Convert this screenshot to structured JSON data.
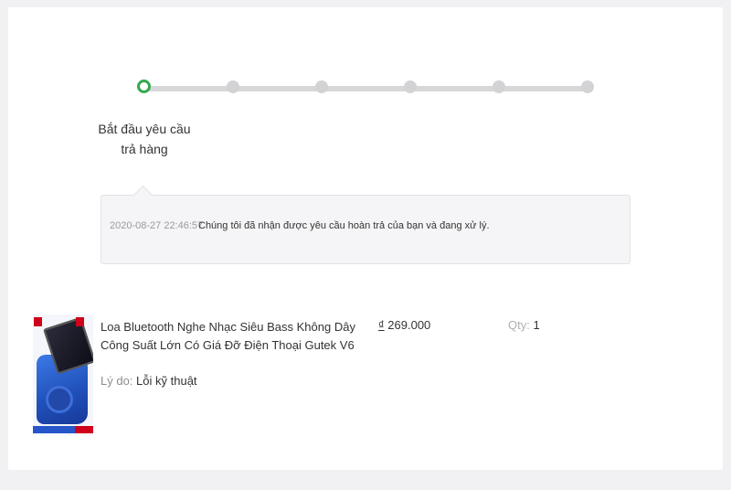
{
  "stepper": {
    "steps": [
      {
        "label": "Bắt đầu yêu cầu trả hàng",
        "state": "active"
      },
      {
        "label": "",
        "state": "pending"
      },
      {
        "label": "",
        "state": "pending"
      },
      {
        "label": "",
        "state": "pending"
      },
      {
        "label": "",
        "state": "pending"
      },
      {
        "label": "",
        "state": "pending"
      }
    ],
    "active_color": "#35a94f",
    "track_color": "#d7d7d9"
  },
  "message": {
    "timestamp": "2020-08-27 22:46:57",
    "text": "Chúng tôi đã nhận được yêu cầu hoàn trả của bạn và đang xử lý."
  },
  "product": {
    "name": "Loa Bluetooth Nghe Nhạc Siêu Bass Không Dây Công Suất Lớn Có Giá Đỡ Điện Thoại Gutek V6",
    "reason_label": "Lý do:",
    "reason_value": "Lỗi kỹ thuật",
    "currency": "₫",
    "price": "269.000",
    "qty_label": "Qty:",
    "qty_value": "1",
    "image_icon": "bluetooth-speaker-product-image"
  }
}
